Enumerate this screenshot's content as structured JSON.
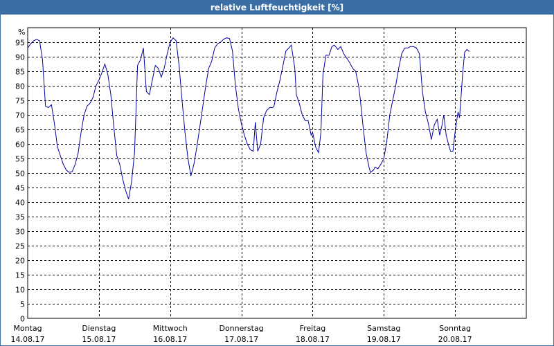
{
  "window": {
    "title": "relative Luftfeuchtigkeit [%]"
  },
  "colors": {
    "line": "#0000a0",
    "titlebar": "#3a6ea5",
    "grid": "#000000"
  },
  "chart_data": {
    "type": "line",
    "title": "relative Luftfeuchtigkeit [%]",
    "ylabel": "%",
    "ylim": [
      0,
      100
    ],
    "y_ticks": [
      0,
      5,
      10,
      15,
      20,
      25,
      30,
      35,
      40,
      45,
      50,
      55,
      60,
      65,
      70,
      75,
      80,
      85,
      90,
      95
    ],
    "grid": true,
    "x_range_hours": [
      0,
      168
    ],
    "days": [
      {
        "day": "Montag",
        "date": "14.08.17"
      },
      {
        "day": "Dienstag",
        "date": "15.08.17"
      },
      {
        "day": "Mittwoch",
        "date": "16.08.17"
      },
      {
        "day": "Donnerstag",
        "date": "17.08.17"
      },
      {
        "day": "Freitag",
        "date": "18.08.17"
      },
      {
        "day": "Samstag",
        "date": "19.08.17"
      },
      {
        "day": "Sonntag",
        "date": "20.08.17"
      }
    ],
    "series": [
      {
        "points": [
          [
            0,
            93
          ],
          [
            1,
            94.5
          ],
          [
            2,
            95.5
          ],
          [
            3,
            96
          ],
          [
            4,
            95.5
          ],
          [
            5,
            89
          ],
          [
            6,
            73
          ],
          [
            7,
            72.5
          ],
          [
            8,
            73.5
          ],
          [
            9,
            67
          ],
          [
            10,
            59
          ],
          [
            11,
            56
          ],
          [
            12,
            53
          ],
          [
            13,
            51
          ],
          [
            14,
            50.2
          ],
          [
            15,
            50.5
          ],
          [
            16,
            53
          ],
          [
            17,
            57
          ],
          [
            18,
            64
          ],
          [
            19,
            70
          ],
          [
            20,
            73
          ],
          [
            21,
            74
          ],
          [
            22,
            76
          ],
          [
            23,
            80
          ],
          [
            24,
            82
          ],
          [
            25,
            84.5
          ],
          [
            26,
            87.5
          ],
          [
            27,
            84
          ],
          [
            28,
            77
          ],
          [
            29,
            66
          ],
          [
            30,
            56
          ],
          [
            31,
            53
          ],
          [
            32,
            48
          ],
          [
            33,
            44
          ],
          [
            34,
            41
          ],
          [
            35,
            47
          ],
          [
            36,
            57
          ],
          [
            37,
            87
          ],
          [
            38,
            89
          ],
          [
            39,
            93
          ],
          [
            40,
            78
          ],
          [
            41,
            77
          ],
          [
            42,
            82
          ],
          [
            43,
            87
          ],
          [
            44,
            86
          ],
          [
            45,
            83
          ],
          [
            46,
            86
          ],
          [
            47,
            91
          ],
          [
            48,
            95
          ],
          [
            49,
            96.5
          ],
          [
            50,
            95.5
          ],
          [
            51,
            87
          ],
          [
            52,
            75
          ],
          [
            53,
            64
          ],
          [
            54,
            55
          ],
          [
            55,
            49
          ],
          [
            56,
            53
          ],
          [
            57,
            59
          ],
          [
            58,
            66
          ],
          [
            59,
            73
          ],
          [
            60,
            80
          ],
          [
            61,
            86
          ],
          [
            62,
            88.5
          ],
          [
            63,
            93
          ],
          [
            64,
            94.5
          ],
          [
            65,
            95
          ],
          [
            66,
            96
          ],
          [
            67,
            96.5
          ],
          [
            68,
            96.3
          ],
          [
            69,
            92
          ],
          [
            70,
            80
          ],
          [
            71,
            72
          ],
          [
            72,
            67
          ],
          [
            73,
            63
          ],
          [
            74,
            60
          ],
          [
            75,
            58
          ],
          [
            76,
            57.5
          ],
          [
            76.7,
            67.5
          ],
          [
            77.5,
            57.5
          ],
          [
            78.5,
            60
          ],
          [
            79.5,
            69
          ],
          [
            80.5,
            71.5
          ],
          [
            81.5,
            72.5
          ],
          [
            82.5,
            72.5
          ],
          [
            83,
            73
          ],
          [
            84,
            78
          ],
          [
            85,
            82
          ],
          [
            86,
            87
          ],
          [
            87,
            92
          ],
          [
            88,
            93
          ],
          [
            88.8,
            94
          ],
          [
            90,
            86
          ],
          [
            90.5,
            77
          ],
          [
            91.5,
            74
          ],
          [
            92.5,
            70
          ],
          [
            93.5,
            68
          ],
          [
            94.5,
            68
          ],
          [
            95.5,
            63
          ],
          [
            96,
            64
          ],
          [
            97,
            59
          ],
          [
            98,
            57
          ],
          [
            98.8,
            64
          ],
          [
            99.5,
            84
          ],
          [
            100.5,
            90.5
          ],
          [
            101.5,
            90.5
          ],
          [
            102.5,
            93.5
          ],
          [
            103.3,
            94
          ],
          [
            104.5,
            92.5
          ],
          [
            105.5,
            93.5
          ],
          [
            106.5,
            91
          ],
          [
            107.5,
            89.5
          ],
          [
            108.5,
            88
          ],
          [
            109.5,
            86
          ],
          [
            110.5,
            85
          ],
          [
            111.5,
            80
          ],
          [
            112,
            76
          ],
          [
            113,
            66
          ],
          [
            114,
            57
          ],
          [
            115,
            52
          ],
          [
            115.5,
            50.2
          ],
          [
            116.5,
            51
          ],
          [
            117,
            52
          ],
          [
            118,
            51.5
          ],
          [
            119,
            53
          ],
          [
            120,
            55
          ],
          [
            121,
            61
          ],
          [
            122,
            70
          ],
          [
            123,
            75
          ],
          [
            124,
            80
          ],
          [
            125,
            86
          ],
          [
            126,
            91
          ],
          [
            127,
            93
          ],
          [
            128,
            93
          ],
          [
            129,
            93.5
          ],
          [
            130,
            93.5
          ],
          [
            131,
            93
          ],
          [
            132,
            91
          ],
          [
            133,
            78
          ],
          [
            134,
            71
          ],
          [
            135,
            67
          ],
          [
            136,
            61.5
          ],
          [
            137,
            66.5
          ],
          [
            138,
            68.5
          ],
          [
            138.8,
            63
          ],
          [
            139.5,
            66
          ],
          [
            140.2,
            70
          ],
          [
            141,
            63
          ],
          [
            142,
            59
          ],
          [
            142.5,
            57.5
          ],
          [
            143.3,
            57.5
          ],
          [
            144,
            64
          ],
          [
            145,
            71
          ],
          [
            145.5,
            69
          ],
          [
            146.5,
            83.5
          ],
          [
            147.2,
            91.5
          ],
          [
            148,
            92.5
          ],
          [
            148.8,
            91.8
          ]
        ]
      }
    ]
  }
}
